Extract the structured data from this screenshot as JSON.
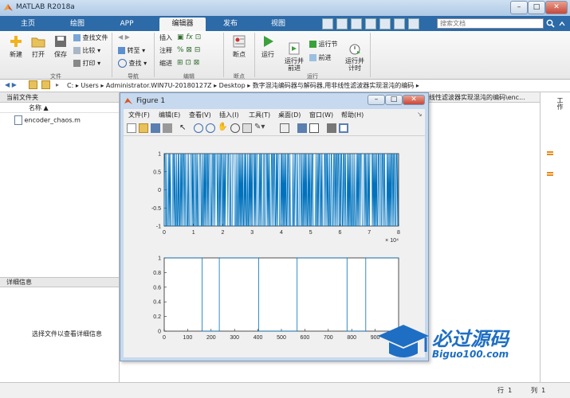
{
  "window": {
    "title": "MATLAB R2018a",
    "search_placeholder": "搜索文档"
  },
  "tabs": [
    {
      "label": "主页"
    },
    {
      "label": "绘图"
    },
    {
      "label": "APP"
    },
    {
      "label": "编辑器"
    },
    {
      "label": "发布"
    },
    {
      "label": "视图"
    }
  ],
  "ribbon": {
    "file": {
      "new": "新建",
      "open": "打开",
      "save": "保存",
      "find_file": "查找文件",
      "compare": "比较",
      "print": "打印",
      "group": "文件"
    },
    "nav": {
      "goto": "转至",
      "find": "查找",
      "group": "导航"
    },
    "edit": {
      "insert": "插入",
      "comment": "注释",
      "indent": "缩进",
      "group": "编辑"
    },
    "bp": {
      "breakpoint": "断点",
      "group": "断点"
    },
    "run": {
      "run": "运行",
      "run_advance": "运行并\n前进",
      "run_section": "运行节",
      "advance": "前进",
      "run_time": "运行并\n计时",
      "group": "运行"
    }
  },
  "address": {
    "parts": [
      "C:",
      "Users",
      "Administrator.WIN7U-20180127Z",
      "Desktop",
      "数字混沌编码器与解码器,用非线性滤波器实现混沌的编码"
    ]
  },
  "current_folder": {
    "title": "当前文件夹",
    "col_name": "名称",
    "files": [
      "encoder_chaos.m"
    ]
  },
  "details": {
    "title": "详细信息",
    "hint": "选择文件以查看详细信息"
  },
  "editor_tab": {
    "label": "线性滤波器实现混沌的编码\\enc..."
  },
  "right_panel": {
    "label": "工作"
  },
  "status": {
    "row_label": "行",
    "row_value": "1",
    "col_label": "列",
    "col_value": "1"
  },
  "figure": {
    "title": "Figure 1",
    "menu": [
      "文件(F)",
      "编辑(E)",
      "查看(V)",
      "插入(I)",
      "工具(T)",
      "桌面(D)",
      "窗口(W)",
      "帮助(H)"
    ]
  },
  "colors": {
    "plot": "#0072bd",
    "tab_bar": "#2c6aa8"
  },
  "watermark": {
    "text": "必过源码",
    "url": "Biguo100.com"
  },
  "chart_data": [
    {
      "type": "line",
      "xlim": [
        0,
        80000
      ],
      "ylim": [
        -1,
        1
      ],
      "x_ticks": [
        "0",
        "1",
        "2",
        "3",
        "4",
        "5",
        "6",
        "7",
        "8"
      ],
      "y_ticks": [
        "1",
        "0.5",
        "0",
        "-0.5",
        "-1"
      ],
      "x_exponent": "× 10⁴",
      "grid": false
    },
    {
      "type": "line",
      "xlim": [
        0,
        1000
      ],
      "ylim": [
        0,
        1
      ],
      "x_ticks": [
        "0",
        "100",
        "200",
        "300",
        "400",
        "500",
        "600",
        "700",
        "800",
        "900"
      ],
      "y_ticks": [
        "1",
        "0.8",
        "0.6",
        "0.4",
        "0.2",
        "0"
      ],
      "x": [
        0,
        162,
        162,
        235,
        235,
        403,
        403,
        567,
        567,
        780,
        780,
        860,
        860,
        1000
      ],
      "y": [
        1,
        1,
        0,
        0,
        1,
        1,
        0,
        0,
        1,
        1,
        0,
        0,
        1,
        1
      ],
      "grid": false
    }
  ]
}
